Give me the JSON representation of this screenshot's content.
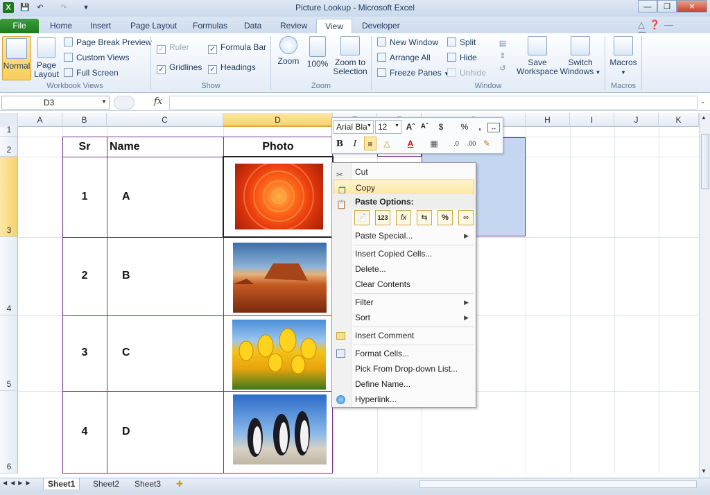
{
  "window": {
    "title": "Picture Lookup  -  Microsoft Excel"
  },
  "tabs": [
    "File",
    "Home",
    "Insert",
    "Page Layout",
    "Formulas",
    "Data",
    "Review",
    "View",
    "Developer"
  ],
  "ribbon": {
    "workbook_views": {
      "label": "Workbook Views",
      "normal": "Normal",
      "page_layout": "Page Layout",
      "page_break": "Page Break Preview",
      "custom_views": "Custom Views",
      "full_screen": "Full Screen"
    },
    "show": {
      "label": "Show",
      "ruler": "Ruler",
      "formula_bar": "Formula Bar",
      "gridlines": "Gridlines",
      "headings": "Headings"
    },
    "zoom": {
      "label": "Zoom",
      "zoom": "Zoom",
      "zoom100": "100%",
      "zoom_selection": "Zoom to Selection"
    },
    "window": {
      "label": "Window",
      "new_window": "New Window",
      "arrange_all": "Arrange All",
      "freeze_panes": "Freeze Panes",
      "split": "Split",
      "hide": "Hide",
      "unhide": "Unhide",
      "save_workspace": "Save Workspace",
      "switch_windows": "Switch Windows"
    },
    "macros": {
      "label": "Macros",
      "macros": "Macros"
    }
  },
  "formula_bar": {
    "name_box": "D3",
    "fx": "fx"
  },
  "columns": [
    "A",
    "B",
    "C",
    "D",
    "E",
    "F",
    "G",
    "H",
    "I",
    "J",
    "K"
  ],
  "rows": [
    "1",
    "2",
    "3",
    "4",
    "5",
    "6"
  ],
  "table": {
    "headers": [
      "Sr",
      "Name",
      "Photo"
    ],
    "rows": [
      {
        "sr": "1",
        "name": "A"
      },
      {
        "sr": "2",
        "name": "B"
      },
      {
        "sr": "3",
        "name": "C"
      },
      {
        "sr": "4",
        "name": "D"
      }
    ]
  },
  "minibar": {
    "font": "Arial Bla",
    "size": "12"
  },
  "context_menu": {
    "cut": "Cut",
    "copy": "Copy",
    "paste_options": "Paste Options:",
    "paste_special": "Paste Special...",
    "insert_copied": "Insert Copied Cells...",
    "delete": "Delete...",
    "clear": "Clear Contents",
    "filter": "Filter",
    "sort": "Sort",
    "insert_comment": "Insert Comment",
    "format_cells": "Format Cells...",
    "pick": "Pick From Drop-down List...",
    "define_name": "Define Name...",
    "hyperlink": "Hyperlink..."
  },
  "sheets": [
    "Sheet1",
    "Sheet2",
    "Sheet3"
  ],
  "colors": {
    "accent": "#1e7a1e",
    "selection": "#c5d7f0",
    "table_border": "#7a2e8a"
  }
}
